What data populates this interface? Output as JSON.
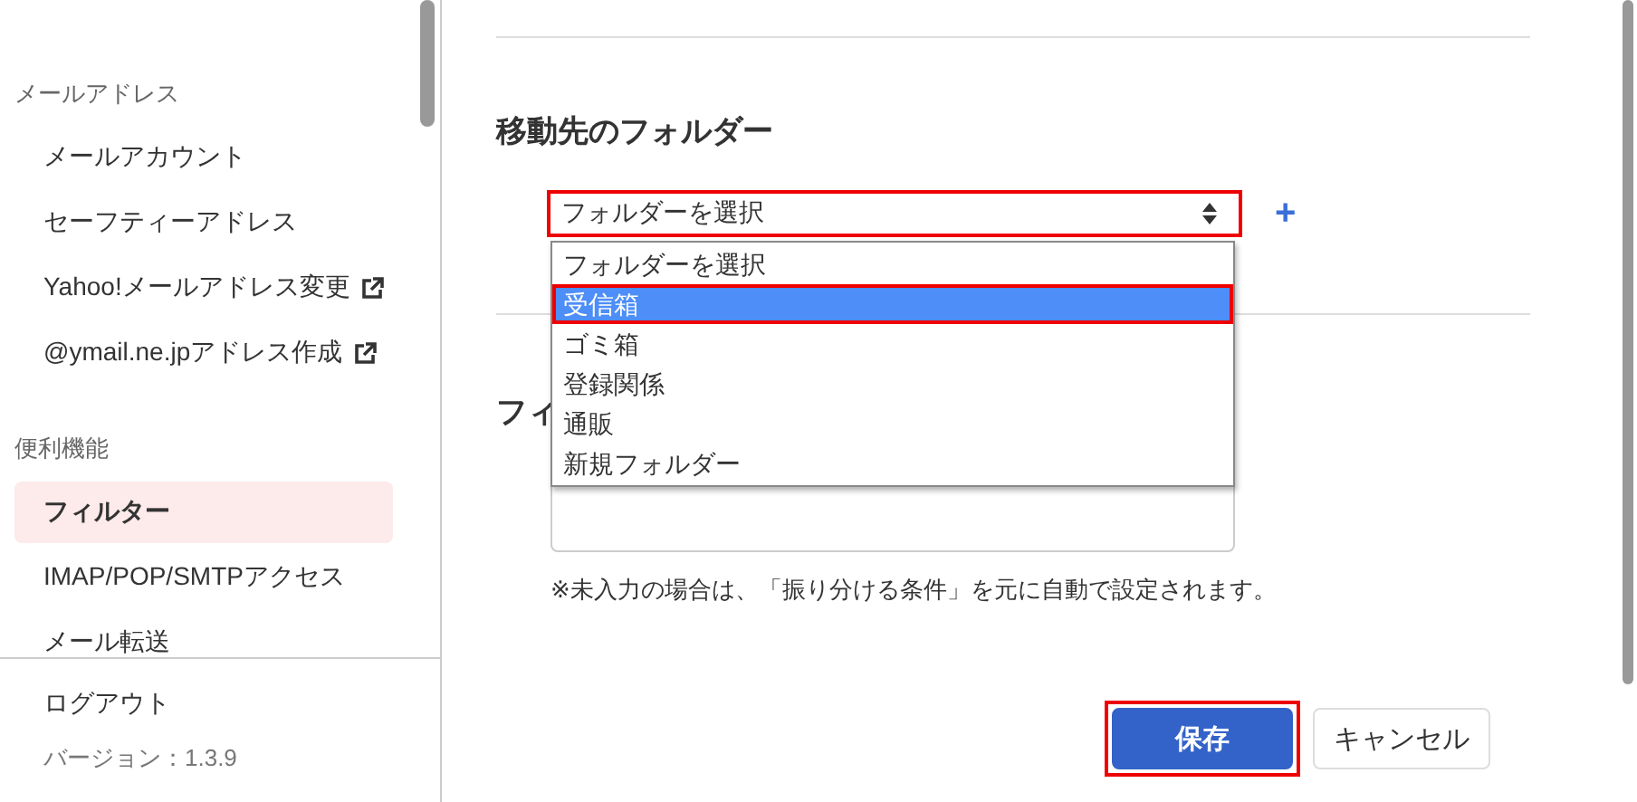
{
  "sidebar": {
    "sections": [
      {
        "title": "メールアドレス",
        "items": [
          {
            "label": "メールアカウント",
            "external": false,
            "selected": false
          },
          {
            "label": "セーフティーアドレス",
            "external": false,
            "selected": false
          },
          {
            "label": "Yahoo!メールアドレス変更",
            "external": true,
            "selected": false
          },
          {
            "label": "@ymail.ne.jpアドレス作成",
            "external": true,
            "selected": false
          }
        ]
      },
      {
        "title": "便利機能",
        "items": [
          {
            "label": "フィルター",
            "external": false,
            "selected": true
          },
          {
            "label": "IMAP/POP/SMTPアクセス",
            "external": false,
            "selected": false
          },
          {
            "label": "メール転送",
            "external": false,
            "selected": false
          }
        ]
      }
    ],
    "logout": "ログアウト",
    "version": "バージョン：1.3.9"
  },
  "folder": {
    "heading": "移動先のフォルダー",
    "select": {
      "value": "フォルダーを選択",
      "highlighted": true,
      "expanded": true
    },
    "options": [
      {
        "label": "フォルダーを選択",
        "selected": false,
        "highlighted": false
      },
      {
        "label": "受信箱",
        "selected": true,
        "highlighted": true
      },
      {
        "label": "ゴミ箱",
        "selected": false,
        "highlighted": false
      },
      {
        "label": "登録関係",
        "selected": false,
        "highlighted": false
      },
      {
        "label": "通販",
        "selected": false,
        "highlighted": false
      },
      {
        "label": "新規フォルダー",
        "selected": false,
        "highlighted": false
      }
    ],
    "add": "+"
  },
  "filter_name": {
    "heading": "フィ",
    "note": "※未入力の場合は、「振り分ける条件」を元に自動で設定されます。"
  },
  "buttons": [
    {
      "label": "保存",
      "kind": "primary",
      "highlighted": true
    },
    {
      "label": "キャンセル",
      "kind": "secondary",
      "highlighted": false
    }
  ]
}
